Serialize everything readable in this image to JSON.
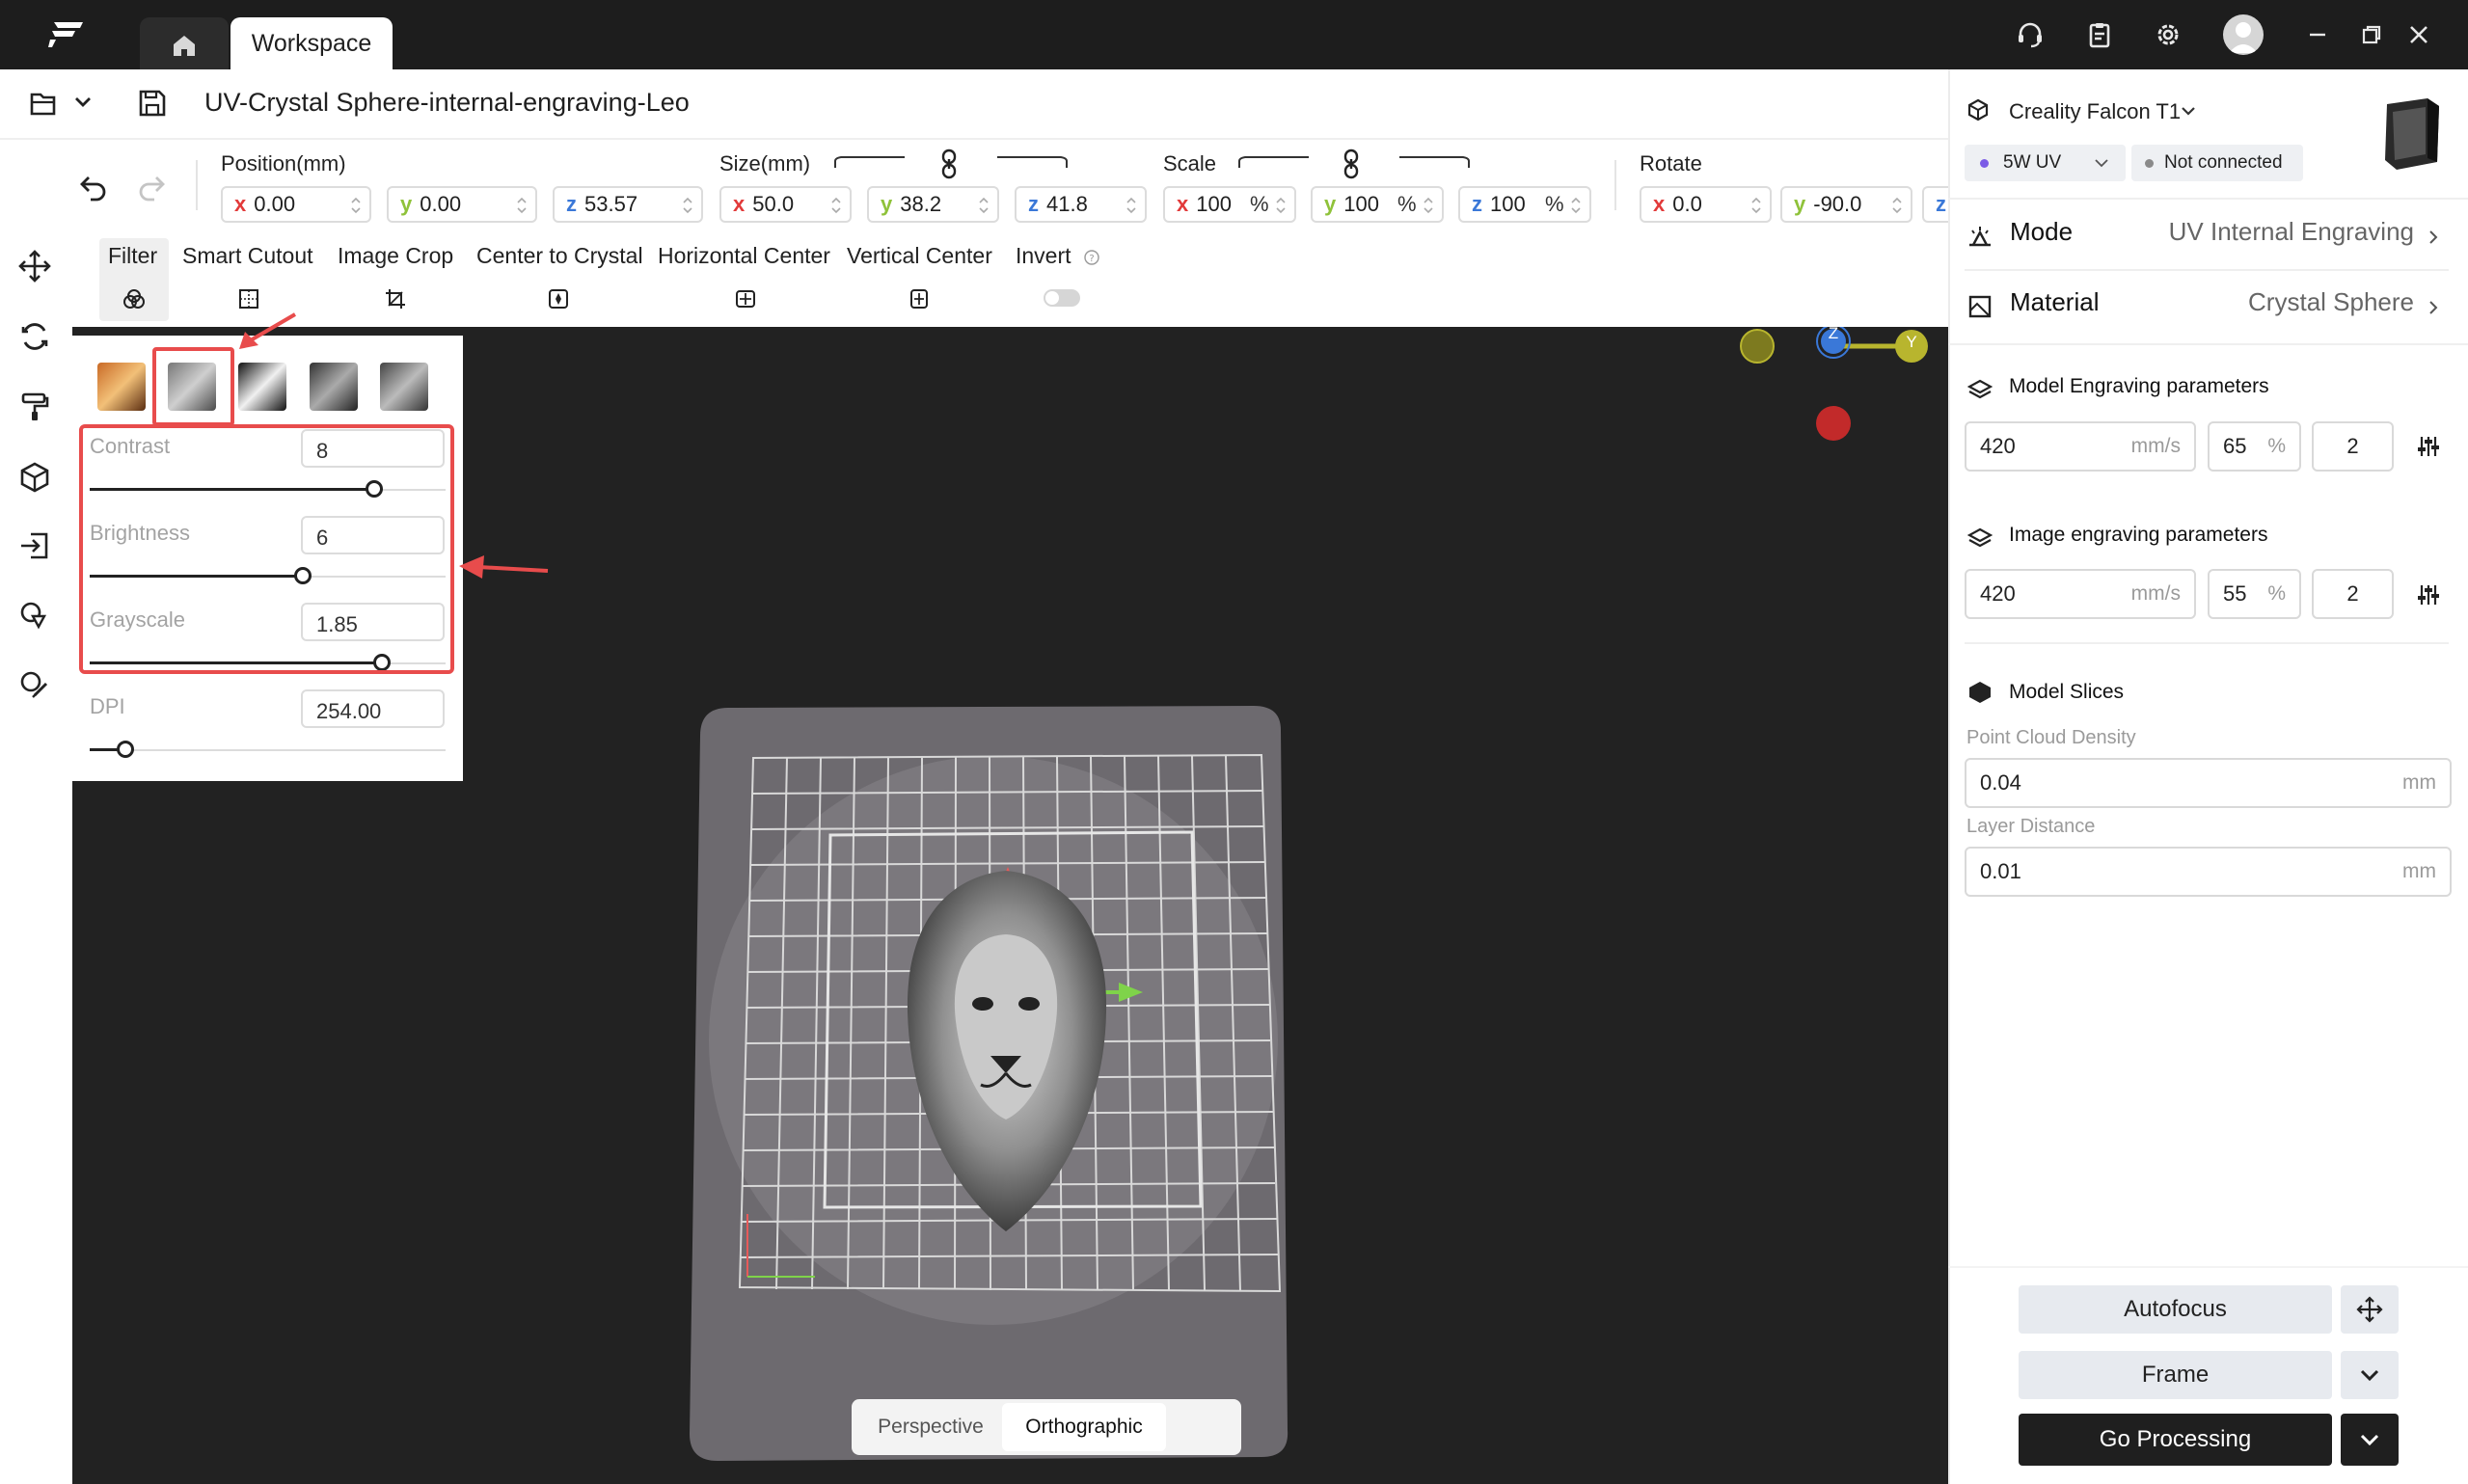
{
  "titlebar": {
    "tab_label": "Workspace",
    "icons": [
      "logo-icon",
      "home-icon",
      "headset-icon",
      "clipboard-icon",
      "settings-icon",
      "avatar",
      "minimize-icon",
      "restore-icon",
      "close-icon"
    ]
  },
  "file": {
    "title": "UV-Crystal Sphere-internal-engraving-Leo"
  },
  "transform": {
    "position_label": "Position(mm)",
    "position": {
      "x": "0.00",
      "y": "0.00",
      "z": "53.57"
    },
    "size_label": "Size(mm)",
    "size": {
      "x": "50.0",
      "y": "38.2",
      "z": "41.8"
    },
    "scale_label": "Scale",
    "scale": {
      "x": "100",
      "y": "100",
      "z": "100",
      "unit": "%"
    },
    "rotate_label": "Rotate",
    "rotate": {
      "x": "0.0",
      "y": "-90.0",
      "z": ""
    },
    "axis": {
      "x": "x",
      "y": "y",
      "z": "z"
    }
  },
  "tools": {
    "filter": "Filter",
    "smart_cutout": "Smart Cutout",
    "image_crop": "Image Crop",
    "center_to_crystal": "Center to Crystal",
    "horizontal_center": "Horizontal Center",
    "vertical_center": "Vertical Center",
    "invert": "Invert",
    "invert_on": false
  },
  "filter_panel": {
    "contrast_label": "Contrast",
    "contrast": "8",
    "contrast_level": 0.8,
    "brightness_label": "Brightness",
    "brightness": "6",
    "brightness_level": 0.6,
    "grayscale_label": "Grayscale",
    "grayscale": "1.85",
    "grayscale_level": 0.82,
    "dpi_label": "DPI",
    "dpi": "254.00",
    "dpi_level": 0.1,
    "selected_filter_index": 1
  },
  "viewport": {
    "view_perspective": "Perspective",
    "view_orthographic": "Orthographic",
    "active_view": "Orthographic",
    "gizmo_z": "Z",
    "gizmo_y": "Y"
  },
  "device": {
    "name": "Creality Falcon T1",
    "laser": "5W UV",
    "status": "Not connected",
    "mode_label": "Mode",
    "mode_value": "UV Internal Engraving",
    "material_label": "Material",
    "material_value": "Crystal Sphere"
  },
  "model_params": {
    "title": "Model Engraving parameters",
    "speed": "420",
    "speed_unit": "mm/s",
    "power": "65",
    "power_unit": "%",
    "passes": "2"
  },
  "image_params": {
    "title": "Image engraving parameters",
    "speed": "420",
    "speed_unit": "mm/s",
    "power": "55",
    "power_unit": "%",
    "passes": "2"
  },
  "slices": {
    "title": "Model Slices",
    "density_label": "Point Cloud Density",
    "density": "0.04",
    "density_unit": "mm",
    "layer_label": "Layer Distance",
    "layer": "0.01",
    "layer_unit": "mm"
  },
  "actions": {
    "autofocus": "Autofocus",
    "frame": "Frame",
    "go_processing": "Go Processing"
  },
  "colors": {
    "accent_red": "#e84c4c",
    "dark": "#1f1f1f",
    "uv_purple": "#7b5ce6"
  }
}
